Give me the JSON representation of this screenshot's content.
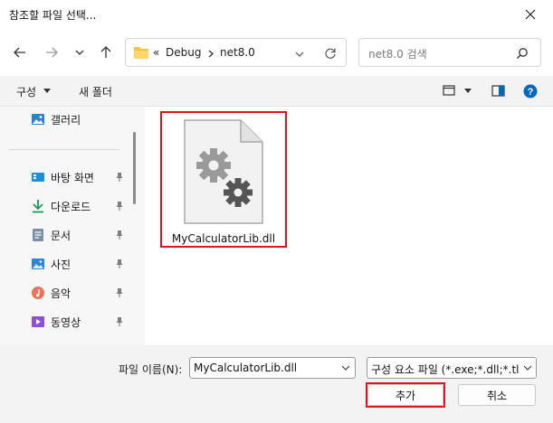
{
  "window": {
    "title": "참조할 파일 선택..."
  },
  "address": {
    "overflow": "«",
    "path": [
      "Debug",
      "net8.0"
    ]
  },
  "search": {
    "placeholder": "net8.0 검색"
  },
  "toolbar": {
    "organize_label": "구성",
    "new_folder_label": "새 폴더"
  },
  "sidebar": {
    "items": [
      {
        "label": "갤러리",
        "icon": "gallery-icon",
        "pinned": false
      },
      {
        "label": "바탕 화면",
        "icon": "desktop-icon",
        "pinned": true
      },
      {
        "label": "다운로드",
        "icon": "download-icon",
        "pinned": true
      },
      {
        "label": "문서",
        "icon": "document-icon",
        "pinned": true
      },
      {
        "label": "사진",
        "icon": "pictures-icon",
        "pinned": true
      },
      {
        "label": "음악",
        "icon": "music-icon",
        "pinned": true
      },
      {
        "label": "동영상",
        "icon": "video-icon",
        "pinned": true
      }
    ]
  },
  "files": [
    {
      "name": "MyCalculatorLib.dll",
      "icon": "dll-file-icon"
    }
  ],
  "footer": {
    "filename_label": "파일 이름(N):",
    "filename_value": "MyCalculatorLib.dll",
    "filetype_value": "구성 요소 파일 (*.exe;*.dll;*.tlb;",
    "add_label": "추가",
    "cancel_label": "취소"
  },
  "colors": {
    "highlight": "#e0141e",
    "folder": "#f5c343",
    "accent": "#0067c0"
  }
}
